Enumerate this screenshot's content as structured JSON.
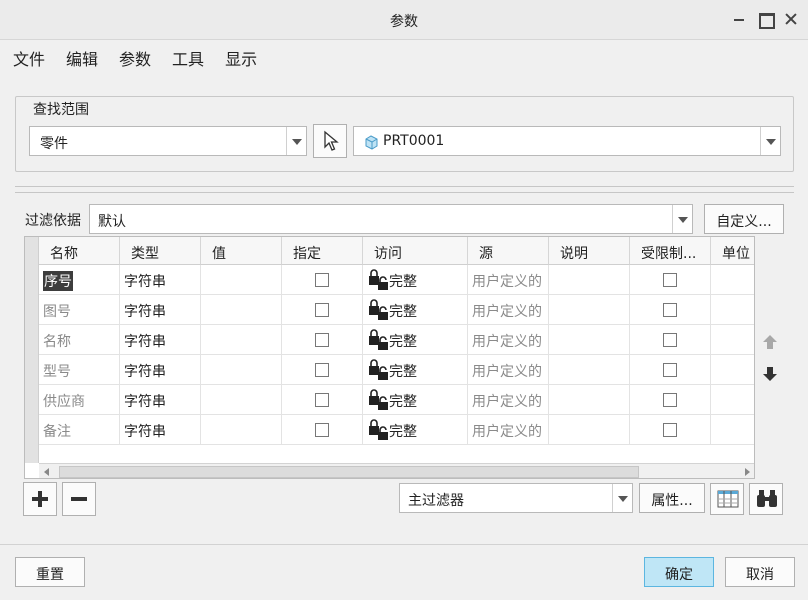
{
  "window": {
    "title": "参数"
  },
  "menu": [
    "文件",
    "编辑",
    "参数",
    "工具",
    "显示"
  ],
  "scope": {
    "legend": "查找范围",
    "type_value": "零件",
    "model_value": "PRT0001"
  },
  "filter": {
    "label": "过滤依据",
    "value": "默认",
    "customize_label": "自定义..."
  },
  "table": {
    "columns": [
      "名称",
      "类型",
      "值",
      "指定",
      "访问",
      "源",
      "说明",
      "受限制...",
      "单位"
    ],
    "rows": [
      {
        "name": "序号",
        "type": "字符串",
        "value": "",
        "designated": false,
        "access": "完整",
        "source": "用户定义的",
        "desc": "",
        "restricted": false
      },
      {
        "name": "图号",
        "type": "字符串",
        "value": "",
        "designated": false,
        "access": "完整",
        "source": "用户定义的",
        "desc": "",
        "restricted": false
      },
      {
        "name": "名称",
        "type": "字符串",
        "value": "",
        "designated": false,
        "access": "完整",
        "source": "用户定义的",
        "desc": "",
        "restricted": false
      },
      {
        "name": "型号",
        "type": "字符串",
        "value": "",
        "designated": false,
        "access": "完整",
        "source": "用户定义的",
        "desc": "",
        "restricted": false
      },
      {
        "name": "供应商",
        "type": "字符串",
        "value": "",
        "designated": false,
        "access": "完整",
        "source": "用户定义的",
        "desc": "",
        "restricted": false
      },
      {
        "name": "备注",
        "type": "字符串",
        "value": "",
        "designated": false,
        "access": "完整",
        "source": "用户定义的",
        "desc": "",
        "restricted": false
      }
    ]
  },
  "bottom_bar": {
    "main_filter_value": "主过滤器",
    "properties_label": "属性..."
  },
  "footer": {
    "reset_label": "重置",
    "ok_label": "确定",
    "cancel_label": "取消"
  },
  "icons": {
    "add": "plus-icon",
    "remove": "minus-icon",
    "move_up": "arrow-up-icon",
    "move_down": "arrow-down-icon",
    "select": "cursor-pointer-icon",
    "part": "part-cube-icon",
    "lock": "lock-icon",
    "columns": "table-columns-icon",
    "search": "binoculars-icon"
  },
  "colors": {
    "ok_button": "#bfe6f6",
    "ok_border": "#5cb6e0",
    "selected_cell": "#3d3d3d"
  }
}
